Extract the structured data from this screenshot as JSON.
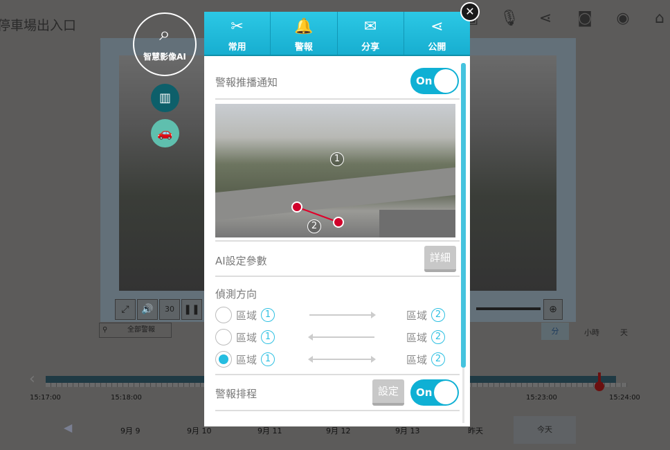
{
  "page": {
    "title": "停車場出入口"
  },
  "toolbar_icons": [
    "screen-icon",
    "microphone-icon",
    "share-icon",
    "camera-icon",
    "eye-icon",
    "home-icon"
  ],
  "player": {
    "replay_label": "30",
    "alarm_filter": "全部警報",
    "units": [
      "分",
      "小時",
      "天"
    ],
    "active_unit": "分"
  },
  "timeline": {
    "labels": [
      "15:17:00",
      "15:18:00",
      "15:23:00",
      "15:24:00"
    ]
  },
  "days": [
    "9月 9",
    "9月 10",
    "9月 11",
    "9月 12",
    "9月 13",
    "昨天",
    "今天"
  ],
  "ai_menu": {
    "label": "智慧影像AI"
  },
  "modal": {
    "tabs": [
      {
        "label": "常用",
        "icon": "tools-icon"
      },
      {
        "label": "警報",
        "icon": "bell-icon"
      },
      {
        "label": "分享",
        "icon": "mail-icon"
      },
      {
        "label": "公開",
        "icon": "share-icon"
      }
    ],
    "push_label": "警報推播通知",
    "push_toggle": "On",
    "zone_markers": [
      "1",
      "2"
    ],
    "ai_params_label": "AI設定參數",
    "details_button": "詳細",
    "direction_label": "偵測方向",
    "zone_word": "區域",
    "directions": [
      {
        "from": "1",
        "to": "2",
        "arrow": "right",
        "selected": false
      },
      {
        "from": "1",
        "to": "2",
        "arrow": "left",
        "selected": false
      },
      {
        "from": "1",
        "to": "2",
        "arrow": "both",
        "selected": true
      }
    ],
    "schedule_label": "警報排程",
    "schedule_button": "設定",
    "schedule_toggle": "On"
  },
  "colors": {
    "accent": "#17aed0",
    "overlay": "#5c5b5a",
    "line": "#e0002a"
  }
}
